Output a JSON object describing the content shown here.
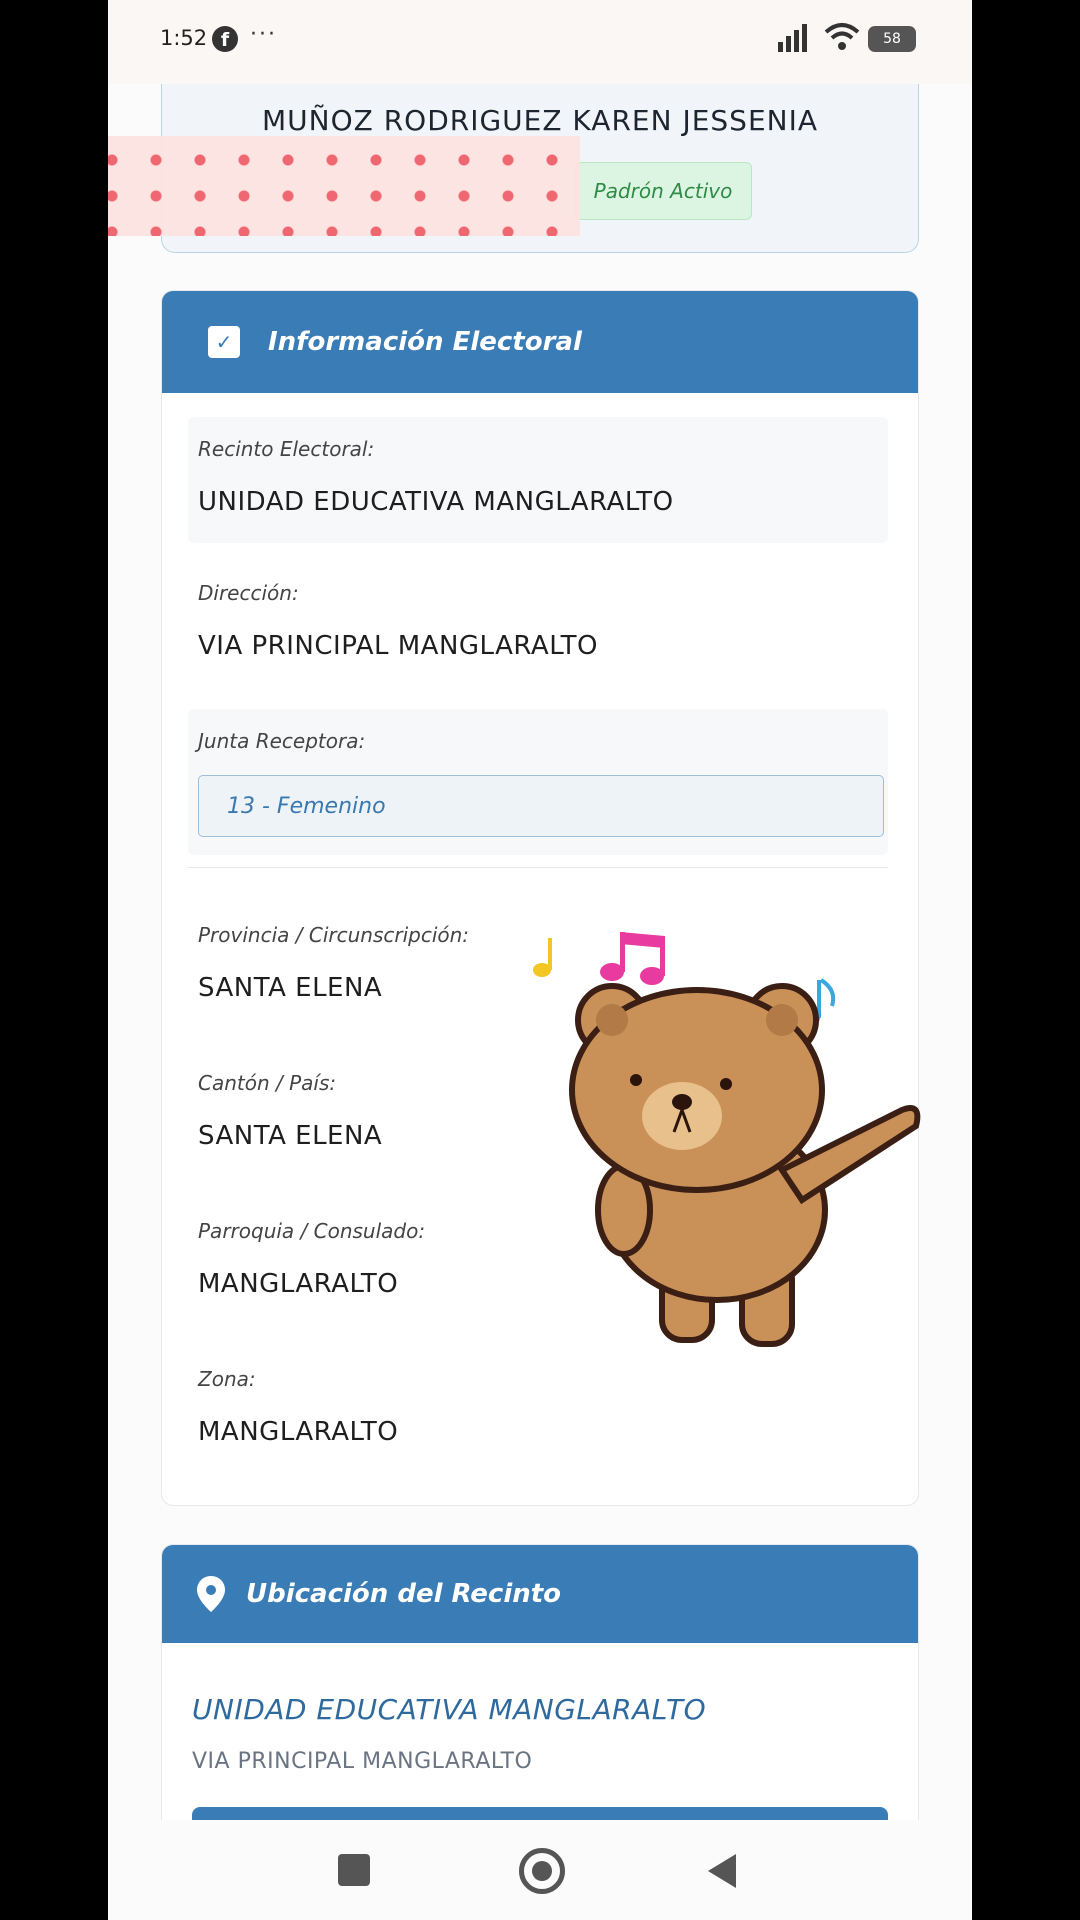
{
  "status_bar": {
    "time": "1:52",
    "battery": "58",
    "overflow": "···"
  },
  "person": {
    "name": "MUÑOZ RODRIGUEZ KAREN JESSENIA",
    "status_badge": "Padrón Activo"
  },
  "electoral_info": {
    "header": "Información Electoral",
    "recinto_label": "Recinto Electoral:",
    "recinto_value": "UNIDAD EDUCATIVA MANGLARALTO",
    "direccion_label": "Dirección:",
    "direccion_value": "VIA PRINCIPAL MANGLARALTO",
    "junta_label": "Junta Receptora:",
    "junta_value": "13 - Femenino",
    "provincia_label": "Provincia / Circunscripción:",
    "provincia_value": "SANTA ELENA",
    "canton_label": "Cantón / País:",
    "canton_value": "SANTA ELENA",
    "parroquia_label": "Parroquia / Consulado:",
    "parroquia_value": "MANGLARALTO",
    "zona_label": "Zona:",
    "zona_value": "MANGLARALTO"
  },
  "location": {
    "header": "Ubicación del Recinto",
    "name": "UNIDAD EDUCATIVA MANGLARALTO",
    "address": "VIA PRINCIPAL MANGLARALTO"
  },
  "colors": {
    "header_blue": "#3a7cb5",
    "badge_green": "#2e8a45",
    "junta_blue": "#3a78b0"
  }
}
